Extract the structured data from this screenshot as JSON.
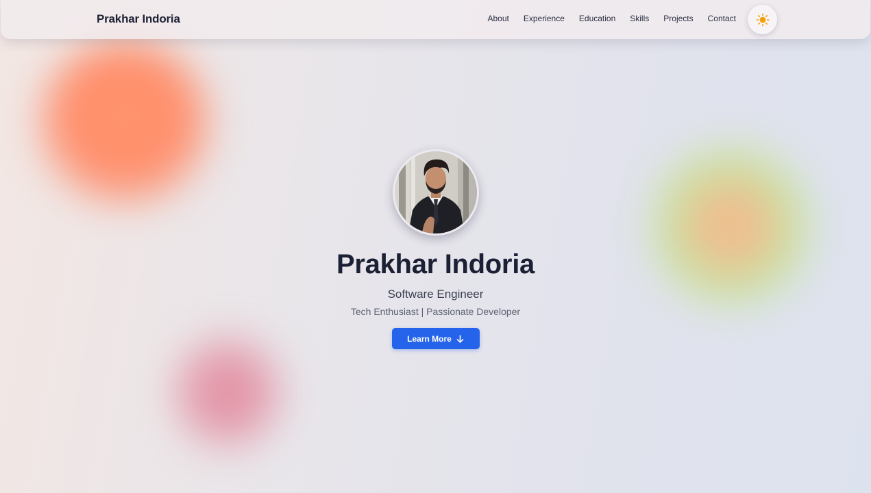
{
  "nav": {
    "brand": "Prakhar Indoria",
    "links": [
      {
        "label": "About"
      },
      {
        "label": "Experience"
      },
      {
        "label": "Education"
      },
      {
        "label": "Skills"
      },
      {
        "label": "Projects"
      },
      {
        "label": "Contact"
      }
    ],
    "theme_toggle": {
      "icon": "sun-icon"
    }
  },
  "hero": {
    "avatar_icon": "profile-photo",
    "name": "Prakhar Indoria",
    "role": "Software Engineer",
    "tagline": "Tech Enthusiast | Passionate Developer",
    "cta_label": "Learn More",
    "cta_icon": "arrow-down-icon"
  },
  "colors": {
    "accent": "#2563eb",
    "text_dark": "#1c2034",
    "sun": "#f59e0b",
    "blob_orange": "#ff8a66",
    "blob_green": "#c4e296",
    "blob_pink": "#e1879b"
  }
}
